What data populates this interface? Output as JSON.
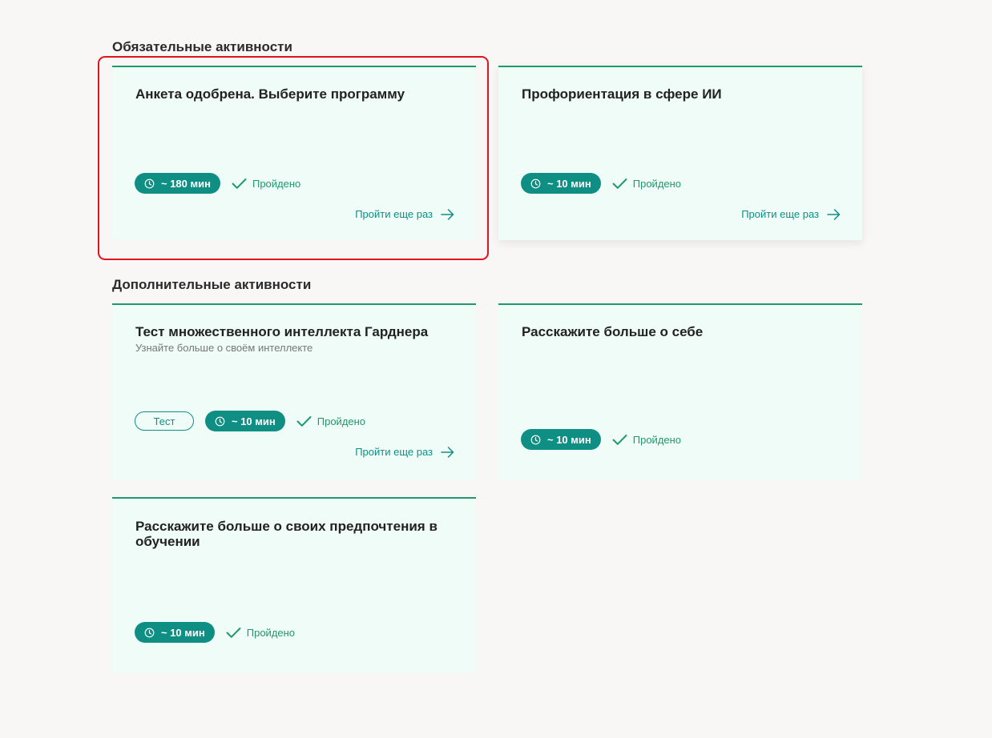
{
  "sections": {
    "mandatory_title": "Обязательные активности",
    "additional_title": "Дополнительные активности"
  },
  "cards": [
    {
      "title": "Анкета одобрена. Выберите программу",
      "duration": "~ 180 мин",
      "status": "Пройдено",
      "retry": "Пройти еще раз"
    },
    {
      "title": "Профориентация в сфере ИИ",
      "duration": "~ 10 мин",
      "status": "Пройдено",
      "retry": "Пройти еще раз"
    },
    {
      "title": "Тест множественного интеллекта Гарднера",
      "subtitle": "Узнайте больше о своём интеллекте",
      "tag": "Тест",
      "duration": "~ 10 мин",
      "status": "Пройдено",
      "retry": "Пройти еще раз"
    },
    {
      "title": "Расскажите больше о себе",
      "duration": "~ 10 мин",
      "status": "Пройдено"
    },
    {
      "title": "Расскажите больше о своих предпочтения в обучении",
      "duration": "~ 10 мин",
      "status": "Пройдено"
    }
  ],
  "colors": {
    "accent": "#0f8f83",
    "success": "#1d9a6c",
    "card_bg": "#effcf7",
    "highlight": "#e3131b"
  },
  "icons": {
    "clock": "clock-icon",
    "check": "check-icon",
    "arrow": "arrow-right-icon"
  }
}
